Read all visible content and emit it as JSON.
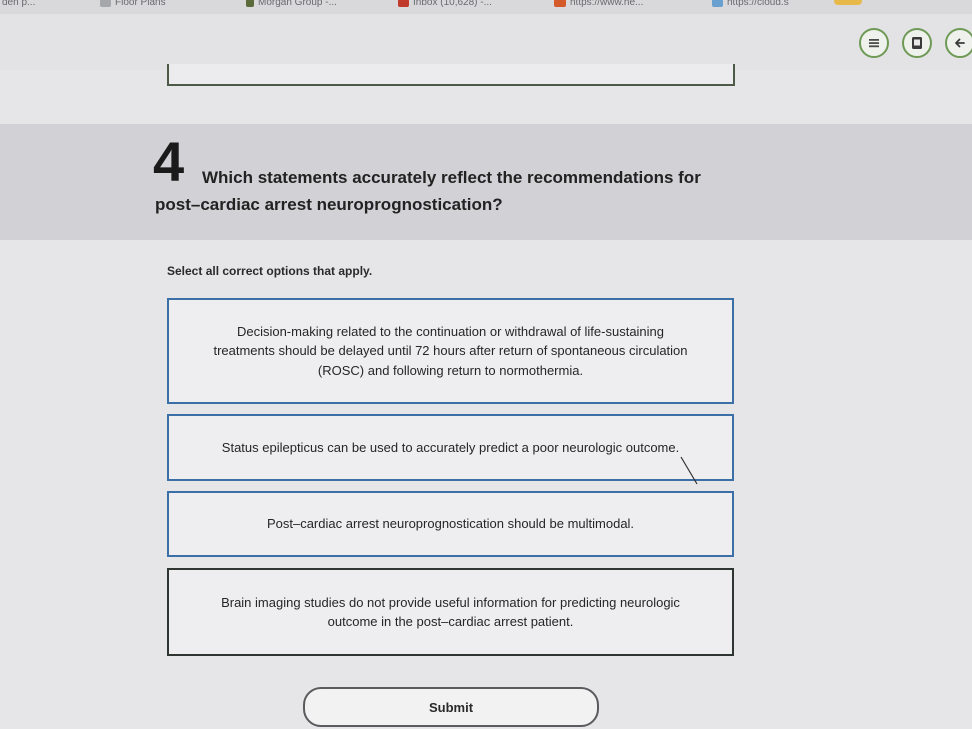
{
  "bookmarks": {
    "items": [
      {
        "label": "den p...",
        "icon_color": "#9aa0a6"
      },
      {
        "label": "Floor Plans",
        "icon_color": "#9aa0a6"
      },
      {
        "label": "Morgan Group -...",
        "icon_color": "#5a6a3a"
      },
      {
        "label": "Inbox (10,628) -...",
        "icon_color": "#c0392b"
      },
      {
        "label": "https://www.he...",
        "icon_color": "#d45a2a"
      },
      {
        "label": "https://cloud.s",
        "icon_color": "#6aa0d0"
      }
    ]
  },
  "toolbar": {
    "menu_icon": "menu-icon",
    "notebook_icon": "notebook-icon",
    "back_icon": "arrow-left-icon",
    "accent": "#6f9a55"
  },
  "question": {
    "number": "4",
    "text_line1": "Which statements accurately reflect the recommendations for",
    "text_line2": "post–cardiac arrest neuroprognostication?",
    "instruction": "Select all correct options that apply."
  },
  "options": [
    {
      "lines": [
        "Decision-making related to the continuation or withdrawal of life-sustaining",
        "treatments should be delayed until 72 hours after return of spontaneous circulation",
        "(ROSC) and following return to normothermia."
      ]
    },
    {
      "lines": [
        "Status epilepticus can be used to accurately predict a poor neurologic outcome."
      ]
    },
    {
      "lines": [
        "Post–cardiac arrest neuroprognostication should be multimodal."
      ]
    },
    {
      "lines": [
        "Brain imaging studies do not provide useful information for predicting neurologic",
        "outcome in the post–cardiac arrest patient."
      ]
    }
  ],
  "submit": {
    "label": "Submit"
  }
}
